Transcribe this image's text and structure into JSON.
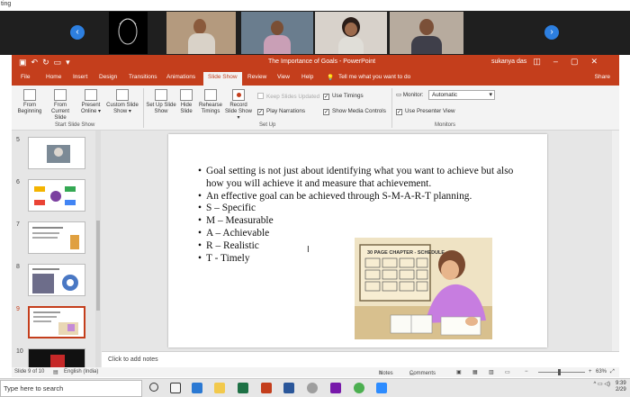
{
  "window": {
    "title_fragment": "ting"
  },
  "meeting": {
    "prev_arrow": "‹",
    "next_arrow": "›"
  },
  "powerpoint": {
    "doc_title": "The Importance of Goals  -  PowerPoint",
    "user": "sukanya das",
    "tabs": [
      "File",
      "Home",
      "Insert",
      "Design",
      "Transitions",
      "Animations",
      "Slide Show",
      "Review",
      "View",
      "Help"
    ],
    "active_tab": "Slide Show",
    "tell_me": "Tell me what you want to do",
    "share": "Share",
    "ribbon": {
      "start_slide_show": {
        "label": "Start Slide Show",
        "buttons": [
          "From Beginning",
          "From Current Slide",
          "Present Online ▾",
          "Custom Slide Show ▾"
        ]
      },
      "set_up": {
        "label": "Set Up",
        "buttons": [
          "Set Up Slide Show",
          "Hide Slide",
          "Rehearse Timings",
          "Record Slide Show ▾"
        ],
        "checks": [
          {
            "label": "Keep Slides Updated",
            "checked": false,
            "disabled": true
          },
          {
            "label": "Use Timings",
            "checked": true,
            "disabled": false
          },
          {
            "label": "Play Narrations",
            "checked": true,
            "disabled": false
          },
          {
            "label": "Show Media Controls",
            "checked": true,
            "disabled": false
          }
        ]
      },
      "monitors": {
        "label": "Monitors",
        "monitor_label": "Monitor:",
        "monitor_value": "Automatic",
        "presenter_view": "Use Presenter View"
      }
    },
    "thumbnails": [
      {
        "num": "5"
      },
      {
        "num": "6"
      },
      {
        "num": "7"
      },
      {
        "num": "8"
      },
      {
        "num": "9"
      },
      {
        "num": "10"
      }
    ],
    "slide": {
      "bullets": [
        "Goal setting is not just about identifying what you want to achieve but also how you will achieve it and measure that achievement.",
        "An effective goal can be achieved through S-M-A-R-T planning.",
        "S – Specific",
        "M – Measurable",
        "A – Achievable",
        " R – Realistic",
        " T - Timely"
      ],
      "image_text": "30 PAGE CHAPTER - SCHEDULE"
    },
    "notes_placeholder": "Click to add notes",
    "status": {
      "slide_of": "Slide 9 of 10",
      "language": "English (India)",
      "notes": "Notes",
      "comments": "Comments",
      "zoom": "63%"
    }
  },
  "taskbar": {
    "search_placeholder": "Type here to search",
    "time": "9:39",
    "date": "2/29"
  },
  "colors": {
    "accent": "#c43e1c",
    "meeting_bg": "#1f1f1f",
    "nav_blue": "#2d7fe0"
  }
}
